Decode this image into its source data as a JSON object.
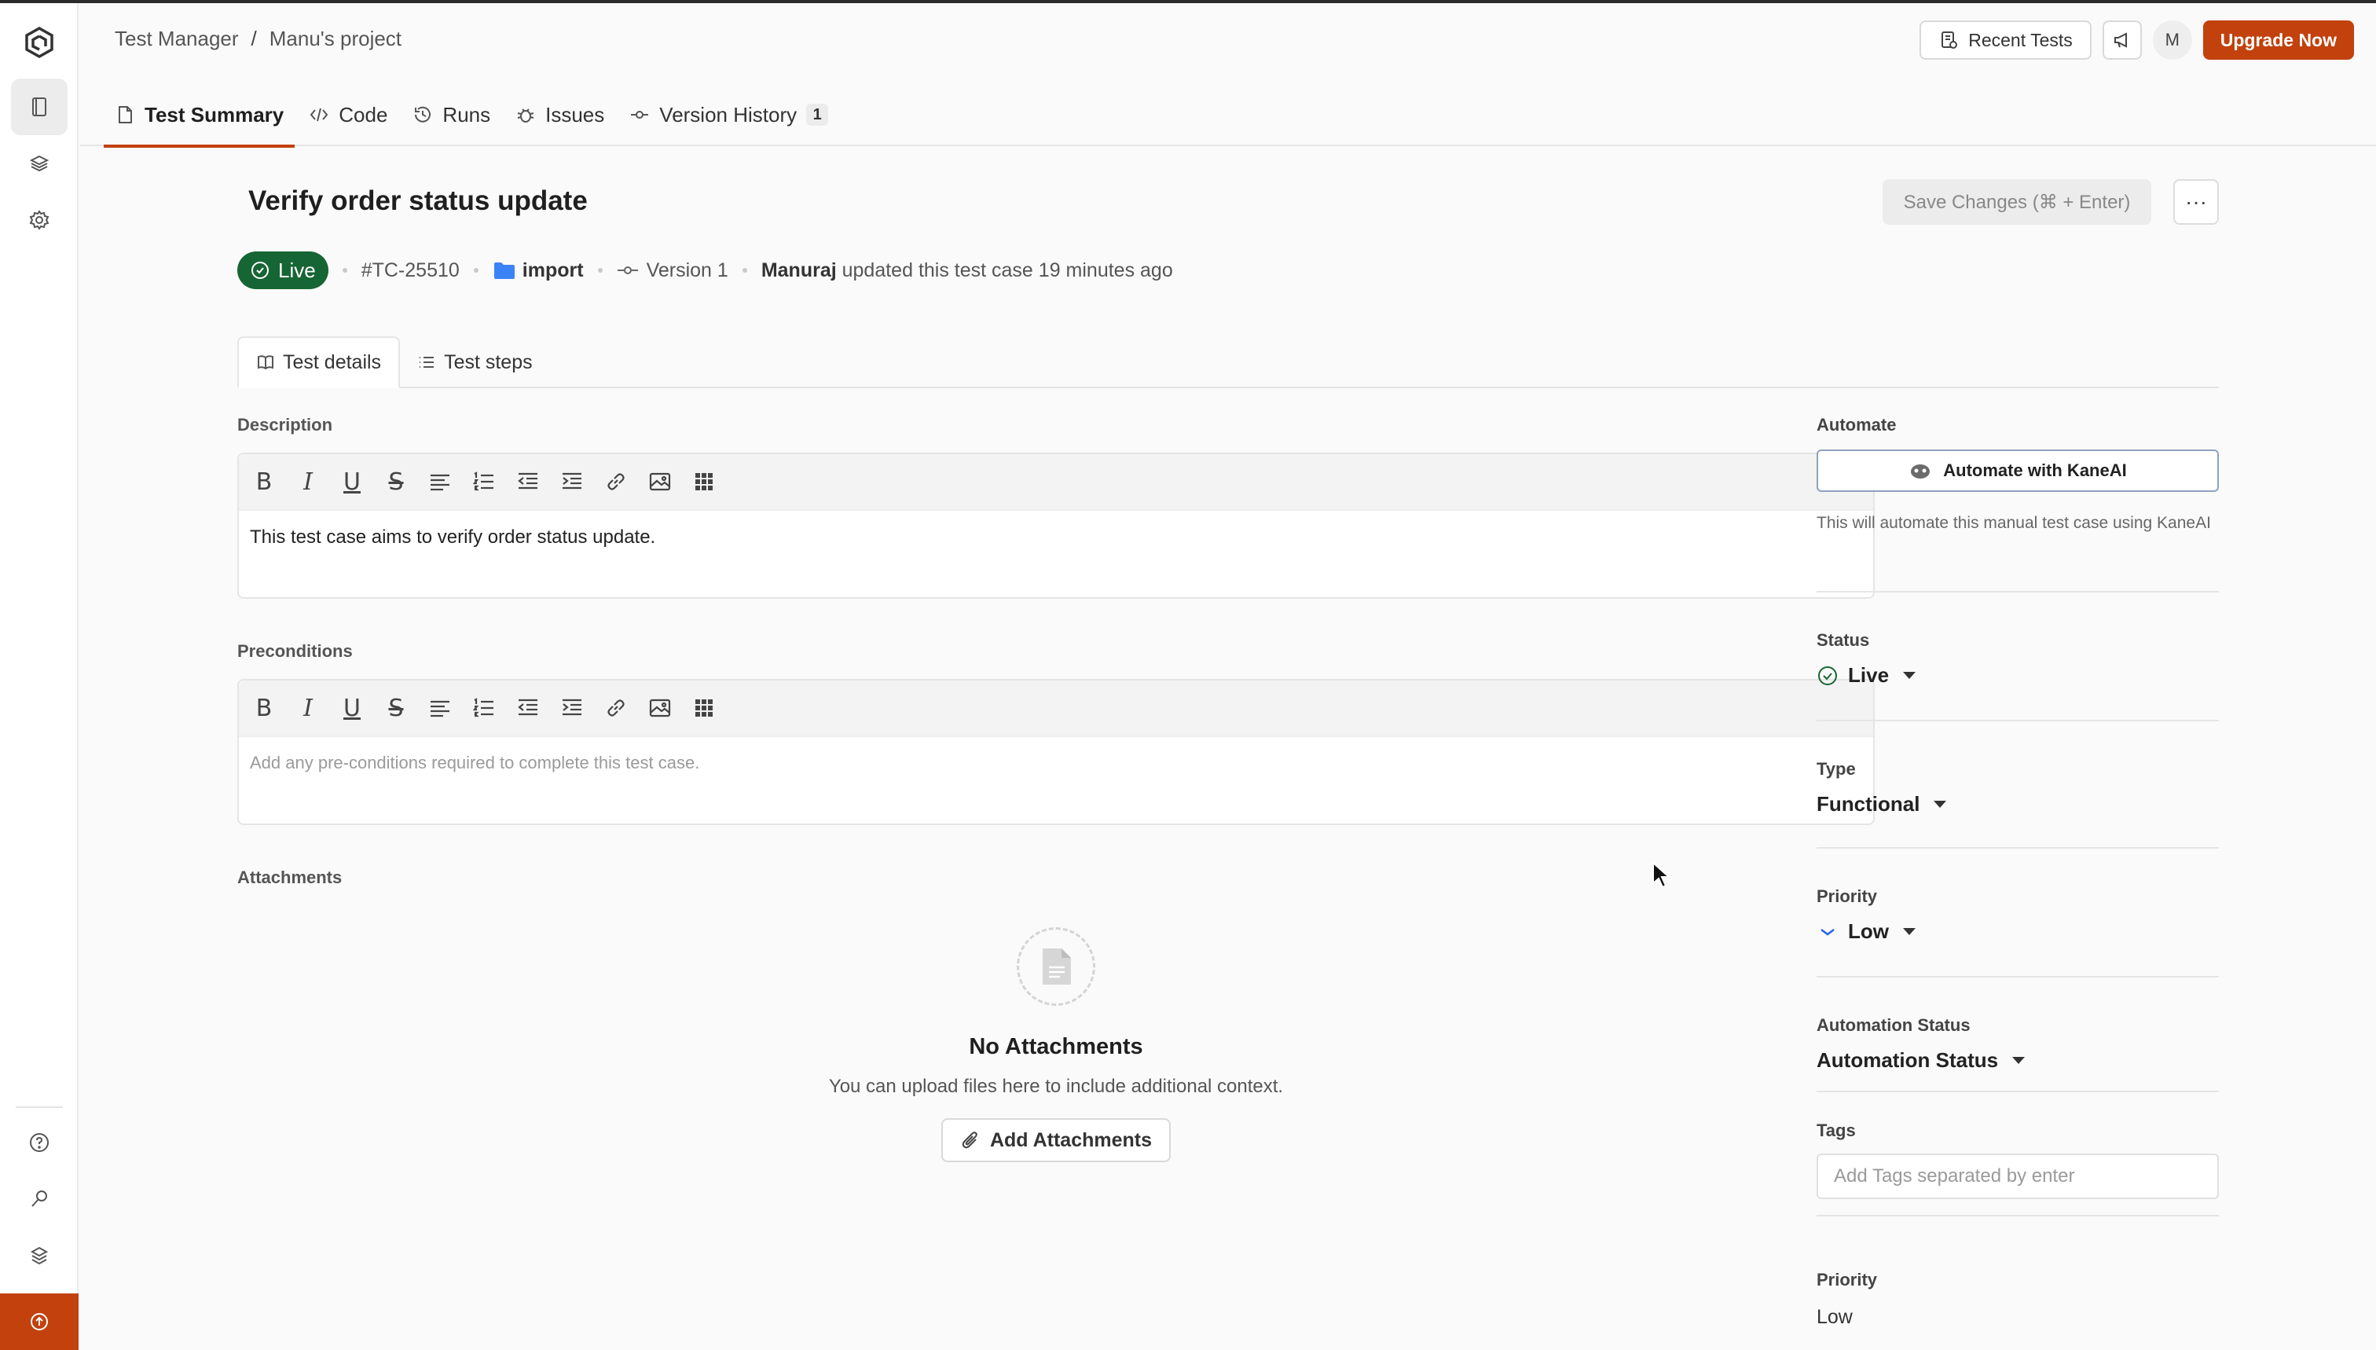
{
  "breadcrumb": {
    "root": "Test Manager",
    "separator": "/",
    "project": "Manu's project"
  },
  "header_actions": {
    "recent_tests": "Recent Tests",
    "avatar_initial": "M",
    "upgrade": "Upgrade Now"
  },
  "tabs": [
    {
      "label": "Test Summary",
      "icon": "document-icon"
    },
    {
      "label": "Code",
      "icon": "code-icon"
    },
    {
      "label": "Runs",
      "icon": "history-icon"
    },
    {
      "label": "Issues",
      "icon": "bug-icon"
    },
    {
      "label": "Version History",
      "icon": "commit-icon",
      "count": "1"
    }
  ],
  "test": {
    "title": "Verify order status update",
    "save_label": "Save Changes (⌘ + Enter)",
    "more_label": "···",
    "status_pill": "Live",
    "id": "#TC-25510",
    "folder": "import",
    "version": "Version 1",
    "updated_by": "Manuraj",
    "updated_text": "updated this test case 19 minutes ago"
  },
  "subtabs": [
    {
      "label": "Test details",
      "icon": "book-icon"
    },
    {
      "label": "Test steps",
      "icon": "list-icon"
    }
  ],
  "description": {
    "label": "Description",
    "content": "This test case aims to verify order status update."
  },
  "preconditions": {
    "label": "Preconditions",
    "placeholder": "Add any pre-conditions required to complete this test case."
  },
  "attachments": {
    "label": "Attachments",
    "empty_title": "No Attachments",
    "empty_subtitle": "You can upload files here to include additional context.",
    "add_button": "Add Attachments"
  },
  "side_panel": {
    "automate_label": "Automate",
    "automate_button": "Automate with KaneAI",
    "automate_note": "This will automate this manual test case using KaneAI",
    "status_label": "Status",
    "status_value": "Live",
    "type_label": "Type",
    "type_value": "Functional",
    "priority_label": "Priority",
    "priority_value": "Low",
    "automation_status_label": "Automation Status",
    "automation_status_value": "Automation Status",
    "tags_label": "Tags",
    "tags_placeholder": "Add Tags separated by enter",
    "priority2_label": "Priority",
    "priority2_value": "Low"
  },
  "colors": {
    "accent": "#c2410c",
    "live_green": "#166534",
    "folder_blue": "#3b82f6"
  }
}
